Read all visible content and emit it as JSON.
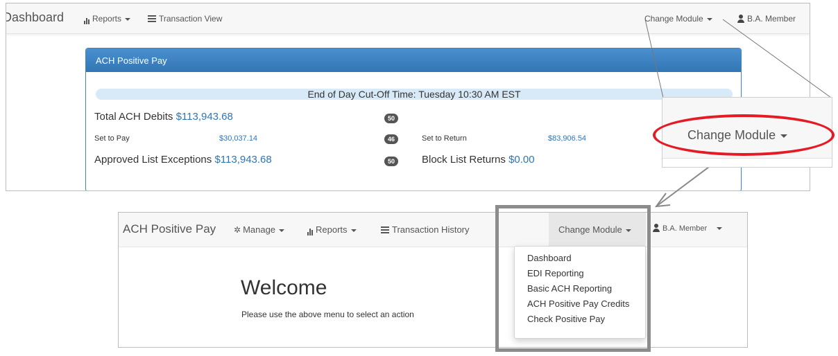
{
  "top_screen": {
    "nav": {
      "brand": "Dashboard",
      "reports": "Reports",
      "transaction_view": "Transaction View",
      "change_module": "Change Module",
      "user": "B.A. Member"
    },
    "panel": {
      "title": "ACH Positive Pay",
      "cutoff": "End of Day Cut-Off Time: Tuesday 10:30 AM EST",
      "total_debits_label": "Total ACH Debits",
      "total_debits_value": "$113,943.68",
      "total_debits_count": "50",
      "set_to_pay_label": "Set to Pay",
      "set_to_pay_value": "$30,037.14",
      "set_to_pay_count": "46",
      "set_to_return_label": "Set to Return",
      "set_to_return_value": "$83,906.54",
      "approved_label": "Approved List Exceptions",
      "approved_value": "$113,943.68",
      "approved_count": "50",
      "block_label": "Block List Returns",
      "block_value": "$0.00"
    }
  },
  "zoom_inset": {
    "label": "Change Module",
    "highlight_color": "#e41b24"
  },
  "bottom_screen": {
    "nav": {
      "brand": "ACH Positive Pay",
      "manage": "Manage",
      "reports": "Reports",
      "transaction_history": "Transaction History",
      "change_module": "Change Module",
      "user": "B.A. Member"
    },
    "dropdown": [
      "Dashboard",
      "EDI Reporting",
      "Basic ACH Reporting",
      "ACH Positive Pay Credits",
      "Check Positive Pay"
    ],
    "welcome_title": "Welcome",
    "welcome_text": "Please use the above menu to select an action",
    "highlight_color": "#8c8c8c"
  },
  "colors": {
    "panel_header": "#3276b4",
    "money": "#2f75b5",
    "cutoff_bar": "#d8eaf7"
  }
}
